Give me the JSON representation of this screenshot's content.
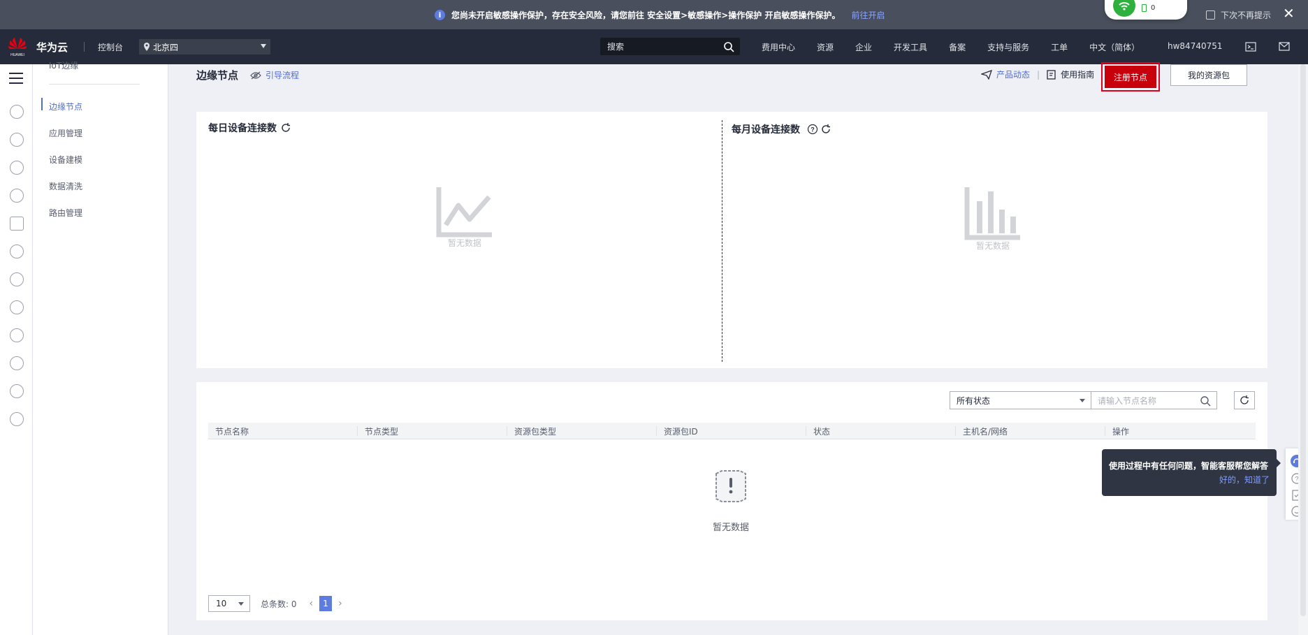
{
  "notice": {
    "message": "您尚未开启敏感操作保护，存在安全风险，请您前往 安全设置>敏感操作>操作保护 开启敏感操作保护。",
    "link": "前往开启",
    "dismiss_label": "下次不再提示",
    "close_glyph": "✕"
  },
  "network_widget": {
    "count": "0"
  },
  "topnav": {
    "brand": "华为云",
    "logo_text": "HUAWEI",
    "console": "控制台",
    "region": "北京四",
    "search_placeholder": "搜索",
    "links": [
      "费用中心",
      "资源",
      "企业",
      "开发工具",
      "备案",
      "支持与服务",
      "工单",
      "中文（简体）"
    ],
    "user": "hw84740751"
  },
  "subnav": {
    "cut_label": "IoT边缘",
    "items": [
      "边缘节点",
      "应用管理",
      "设备建模",
      "数据清洗",
      "路由管理"
    ],
    "active_index": 0
  },
  "header": {
    "title": "边缘节点",
    "guide_link": "引导流程",
    "product_news": "产品动态",
    "separator": "|",
    "user_guide": "使用指南",
    "register_button": "注册节点",
    "my_packages_button": "我的资源包"
  },
  "charts": {
    "daily_title": "每日设备连接数",
    "monthly_title": "每月设备连接数",
    "daily_empty": "暂无数据",
    "monthly_empty": "暂无数据"
  },
  "table": {
    "status_select": "所有状态",
    "name_placeholder": "请输入节点名称",
    "columns": [
      "节点名称",
      "节点类型",
      "资源包类型",
      "资源包ID",
      "状态",
      "主机名/网络",
      "操作"
    ],
    "empty_text": "暂无数据"
  },
  "pagination": {
    "page_size": "10",
    "total_label": "总条数: 0",
    "current_page": "1",
    "prev_glyph": "‹",
    "next_glyph": "›"
  },
  "tooltip": {
    "text": "使用过程中有任何问题，智能客服帮您解答",
    "action": "好的，知道了"
  },
  "colors": {
    "accent": "#526ecc",
    "primary_red": "#c7000b",
    "nav_bg": "#252b3a"
  }
}
